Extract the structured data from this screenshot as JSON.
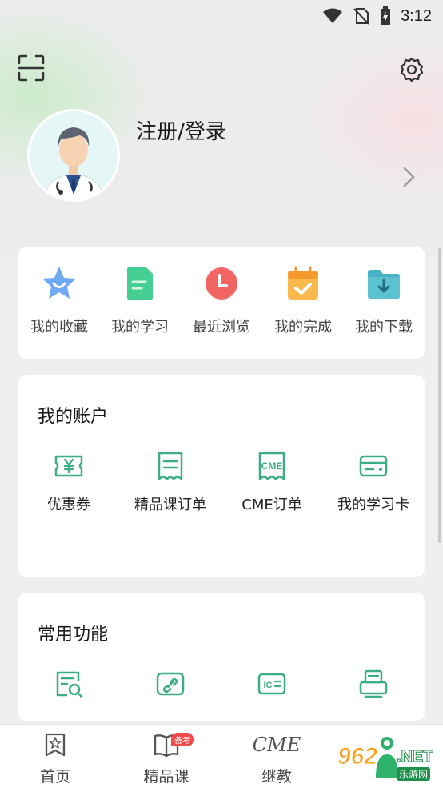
{
  "status_bar": {
    "time": "3:12"
  },
  "header": {
    "login_label": "注册/登录",
    "icons": [
      "scan-icon",
      "gear-icon",
      "chevron-right-icon"
    ]
  },
  "quick_actions": [
    {
      "label": "我的收藏",
      "icon": "star-icon",
      "color": "#5b9cf0"
    },
    {
      "label": "我的学习",
      "icon": "document-icon",
      "color": "#3ec98a"
    },
    {
      "label": "最近浏览",
      "icon": "clock-icon",
      "color": "#f05a5a"
    },
    {
      "label": "我的完成",
      "icon": "calendar-check-icon",
      "color": "#f7a53b"
    },
    {
      "label": "我的下载",
      "icon": "folder-download-icon",
      "color": "#3aa6b9"
    }
  ],
  "account": {
    "title": "我的账户",
    "items": [
      {
        "label": "优惠券",
        "icon": "coupon-icon"
      },
      {
        "label": "精品课订单",
        "icon": "receipt-icon"
      },
      {
        "label": "CME订单",
        "icon": "cme-receipt-icon",
        "icon_text": "CME"
      },
      {
        "label": "我的学习卡",
        "icon": "card-icon"
      }
    ]
  },
  "common": {
    "title": "常用功能",
    "items": [
      {
        "icon": "search-document-icon"
      },
      {
        "icon": "link-icon"
      },
      {
        "icon": "ic-card-icon",
        "icon_text": "IC"
      },
      {
        "icon": "printer-icon"
      }
    ]
  },
  "tabbar": {
    "tabs": [
      {
        "label": "首页",
        "icon": "home-star-icon"
      },
      {
        "label": "精品课",
        "icon": "book-icon",
        "badge": "备考"
      },
      {
        "label": "继教",
        "icon": "cme-logo",
        "icon_text": "CME"
      }
    ]
  },
  "watermark": {
    "number": "962",
    "domain": ".NET",
    "sub": "乐游网"
  },
  "colors": {
    "accent": "#3dae84",
    "background": "#efefef",
    "card": "#ffffff"
  }
}
